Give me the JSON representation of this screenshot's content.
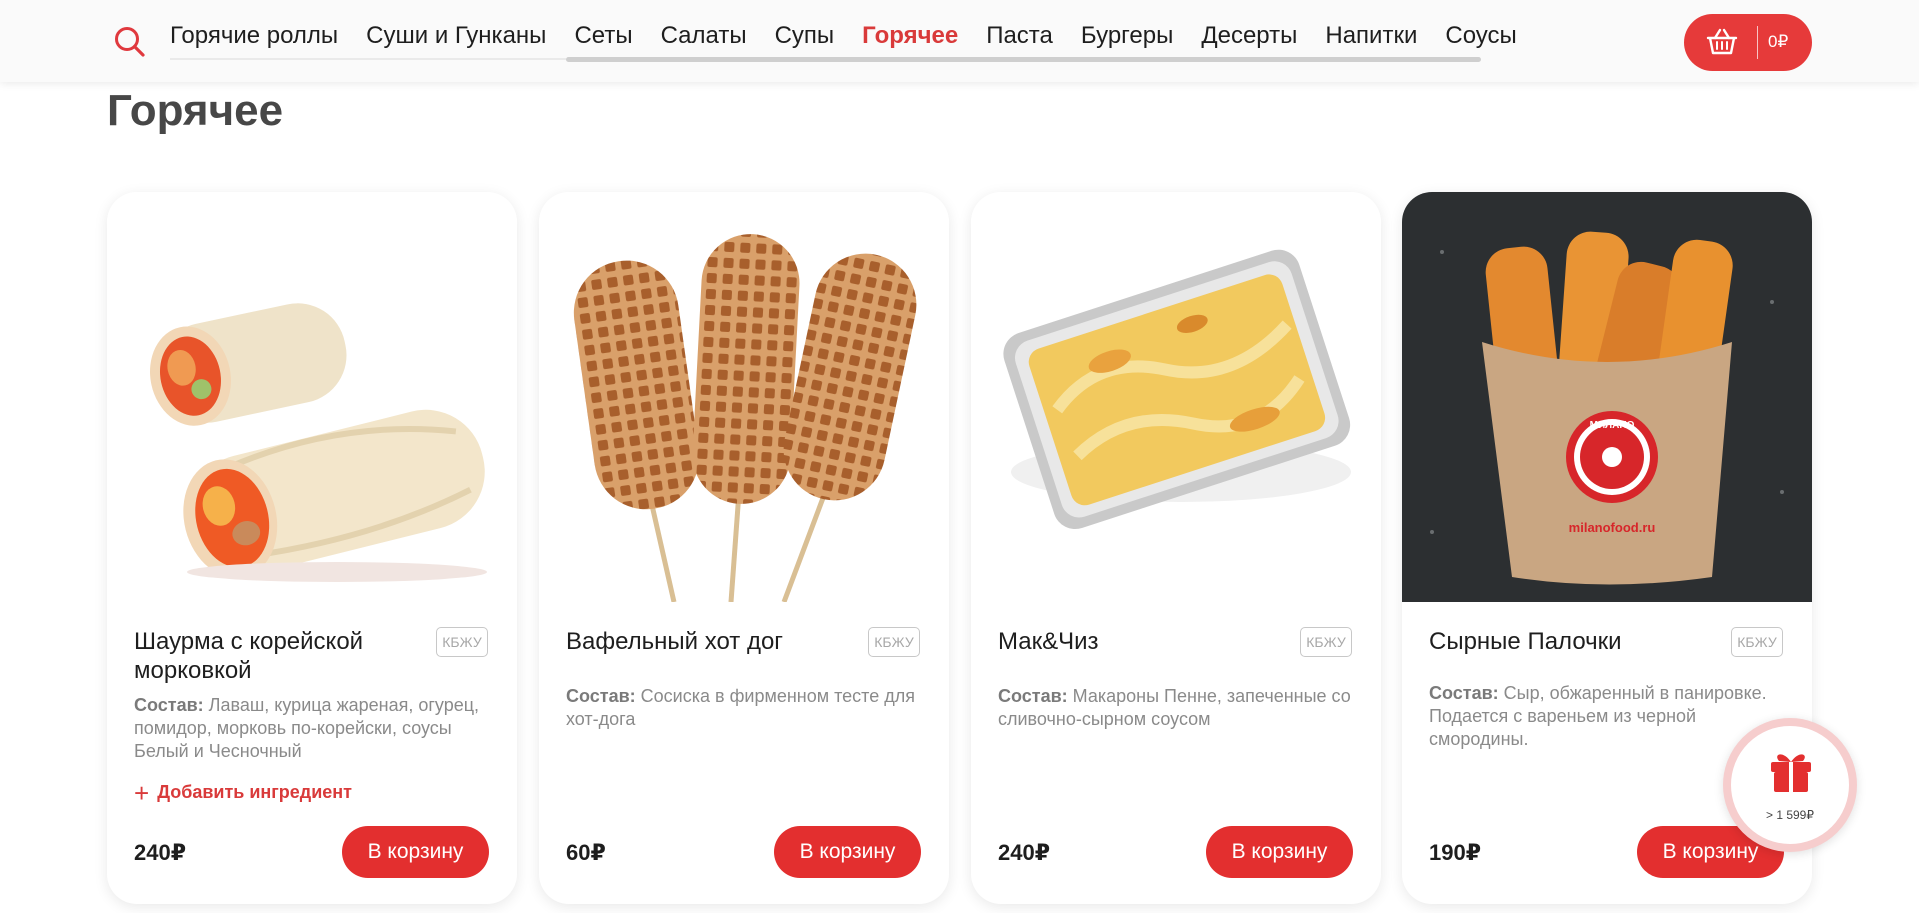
{
  "header": {
    "nav": [
      "Горячие роллы",
      "Суши и Гунканы",
      "Сеты",
      "Салаты",
      "Супы",
      "Горячее",
      "Паста",
      "Бургеры",
      "Десерты",
      "Напитки",
      "Соусы"
    ],
    "active_nav": "Горячее",
    "cart_total": "0₽"
  },
  "page_title": "Горячее",
  "cards": [
    {
      "title": "Шаурма с корейской морковкой",
      "kbju": "КБЖУ",
      "desc_label": "Состав:",
      "desc": "Лаваш, курица жареная, огурец, помидор, морковь по-корейски, соусы Белый и Чесночный",
      "add_ingredient": "Добавить ингредиент",
      "price": "240₽",
      "button": "В корзину"
    },
    {
      "title": "Вафельный хот дог",
      "kbju": "КБЖУ",
      "desc_label": "Состав:",
      "desc": "Сосиска в фирменном тесте для хот-дога",
      "price": "60₽",
      "button": "В корзину"
    },
    {
      "title": "Мак&Чиз",
      "kbju": "КБЖУ",
      "desc_label": "Состав:",
      "desc": "Макароны Пенне, запеченные со сливочно-сырном соусом",
      "price": "240₽",
      "button": "В корзину"
    },
    {
      "title": "Сырные Палочки",
      "kbju": "КБЖУ",
      "desc_label": "Состав:",
      "desc": "Сыр, обжаренный в панировке. Подается с вареньем из черной смородины.",
      "package_brand": "МИЛАНО",
      "package_url": "milanofood.ru",
      "price": "190₽",
      "button": "В корзину"
    }
  ],
  "gift": {
    "label": "> 1 599₽"
  },
  "colors": {
    "accent": "#e32f2f",
    "active_nav": "#d93a3a"
  }
}
